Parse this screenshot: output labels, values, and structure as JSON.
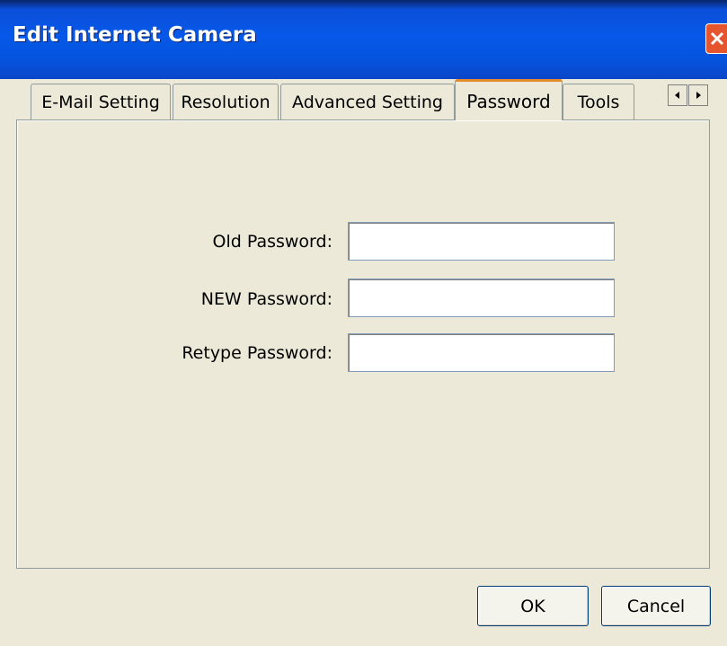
{
  "window": {
    "title": "Edit Internet Camera",
    "close_icon": "close-icon"
  },
  "tabs": [
    {
      "label": "E-Mail Setting",
      "active": false
    },
    {
      "label": "Resolution",
      "active": false
    },
    {
      "label": "Advanced Setting",
      "active": false
    },
    {
      "label": "Password",
      "active": true
    },
    {
      "label": "Tools",
      "active": false
    }
  ],
  "tab_scroll": {
    "left_icon": "scroll-left-icon",
    "right_icon": "scroll-right-icon"
  },
  "password_form": {
    "old_label": "Old Password:",
    "old_value": "",
    "new_label": "NEW Password:",
    "new_value": "",
    "retype_label": "Retype Password:",
    "retype_value": ""
  },
  "buttons": {
    "ok": "OK",
    "cancel": "Cancel"
  },
  "colors": {
    "titlebar": "#0758E9",
    "dialog_bg": "#ECE9D8",
    "active_tab_accent": "#E68B2C",
    "close_button": "#E5562F"
  }
}
